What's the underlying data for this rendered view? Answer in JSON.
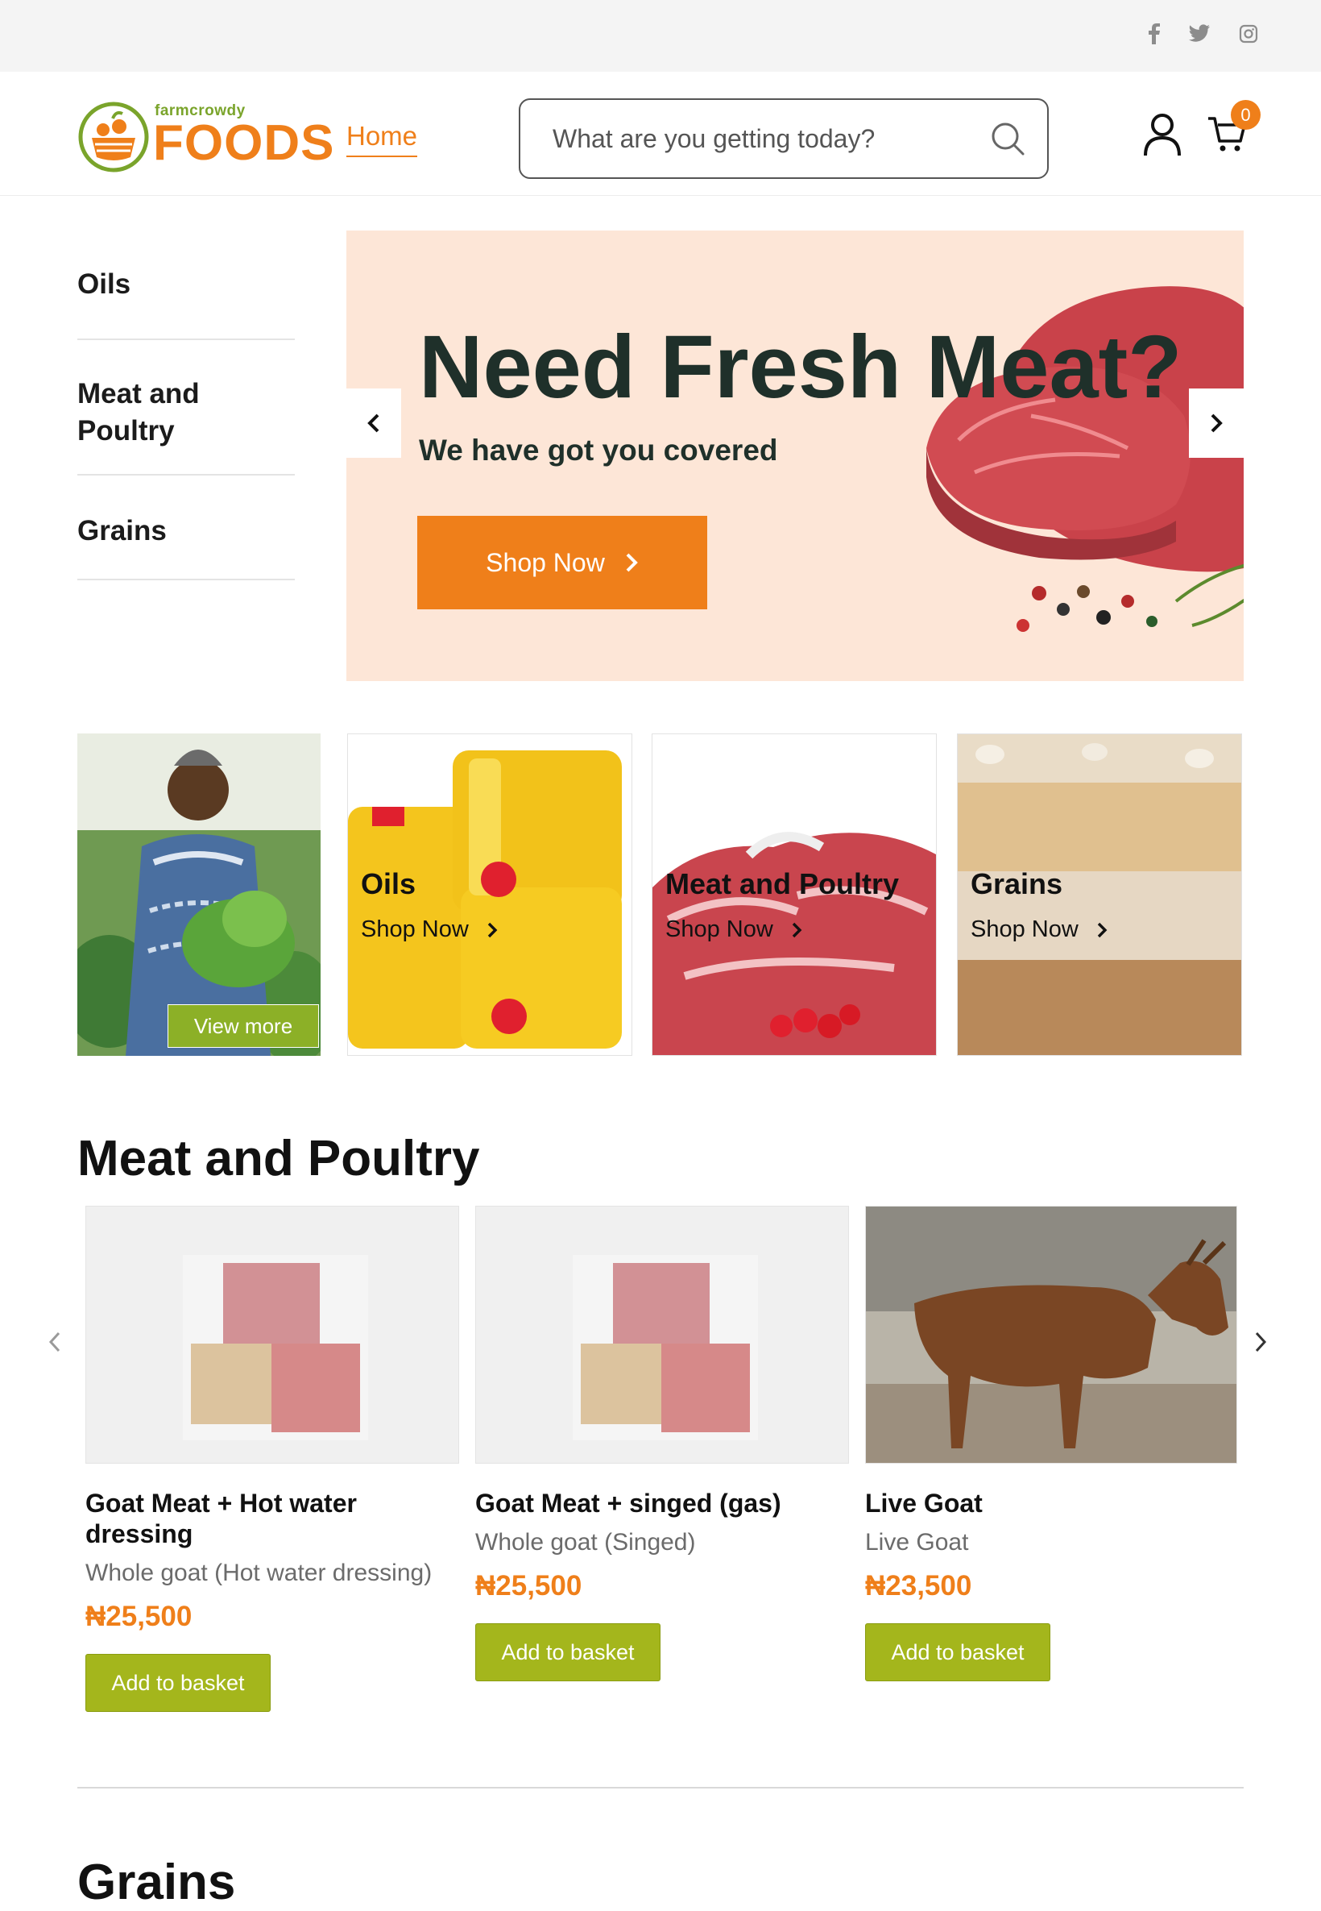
{
  "social": [
    "facebook-icon",
    "twitter-icon",
    "instagram-icon"
  ],
  "brand": {
    "small": "farmcrowdy",
    "big": "FOODS"
  },
  "nav": {
    "home": "Home"
  },
  "search": {
    "placeholder": "What are you getting today?"
  },
  "cart": {
    "count": "0"
  },
  "sidebar": {
    "items": [
      {
        "label": "Oils"
      },
      {
        "label": "Meat and Poultry"
      },
      {
        "label": "Grains"
      }
    ]
  },
  "hero": {
    "title": "Need Fresh Meat?",
    "subtitle": "We have got you covered",
    "button": "Shop Now"
  },
  "categories": {
    "view_more": "View more",
    "items": [
      {
        "title": "Oils",
        "link": "Shop Now"
      },
      {
        "title": "Meat and Poultry",
        "link": "Shop Now"
      },
      {
        "title": "Grains",
        "link": "Shop Now"
      }
    ]
  },
  "sections": {
    "meat": "Meat and Poultry",
    "grains": "Grains"
  },
  "products": [
    {
      "name": "Goat Meat + Hot water dressing",
      "desc": "Whole goat (Hot water dressing)",
      "price": "₦25,500",
      "button": "Add to basket"
    },
    {
      "name": "Goat Meat + singed (gas)",
      "desc": "Whole goat (Singed)",
      "price": "₦25,500",
      "button": "Add to basket"
    },
    {
      "name": "Live Goat",
      "desc": "Live Goat",
      "price": "₦23,500",
      "button": "Add to basket"
    }
  ],
  "colors": {
    "accent": "#ef7f1a",
    "green": "#a4b61c",
    "hero_bg": "#fde6d7"
  }
}
